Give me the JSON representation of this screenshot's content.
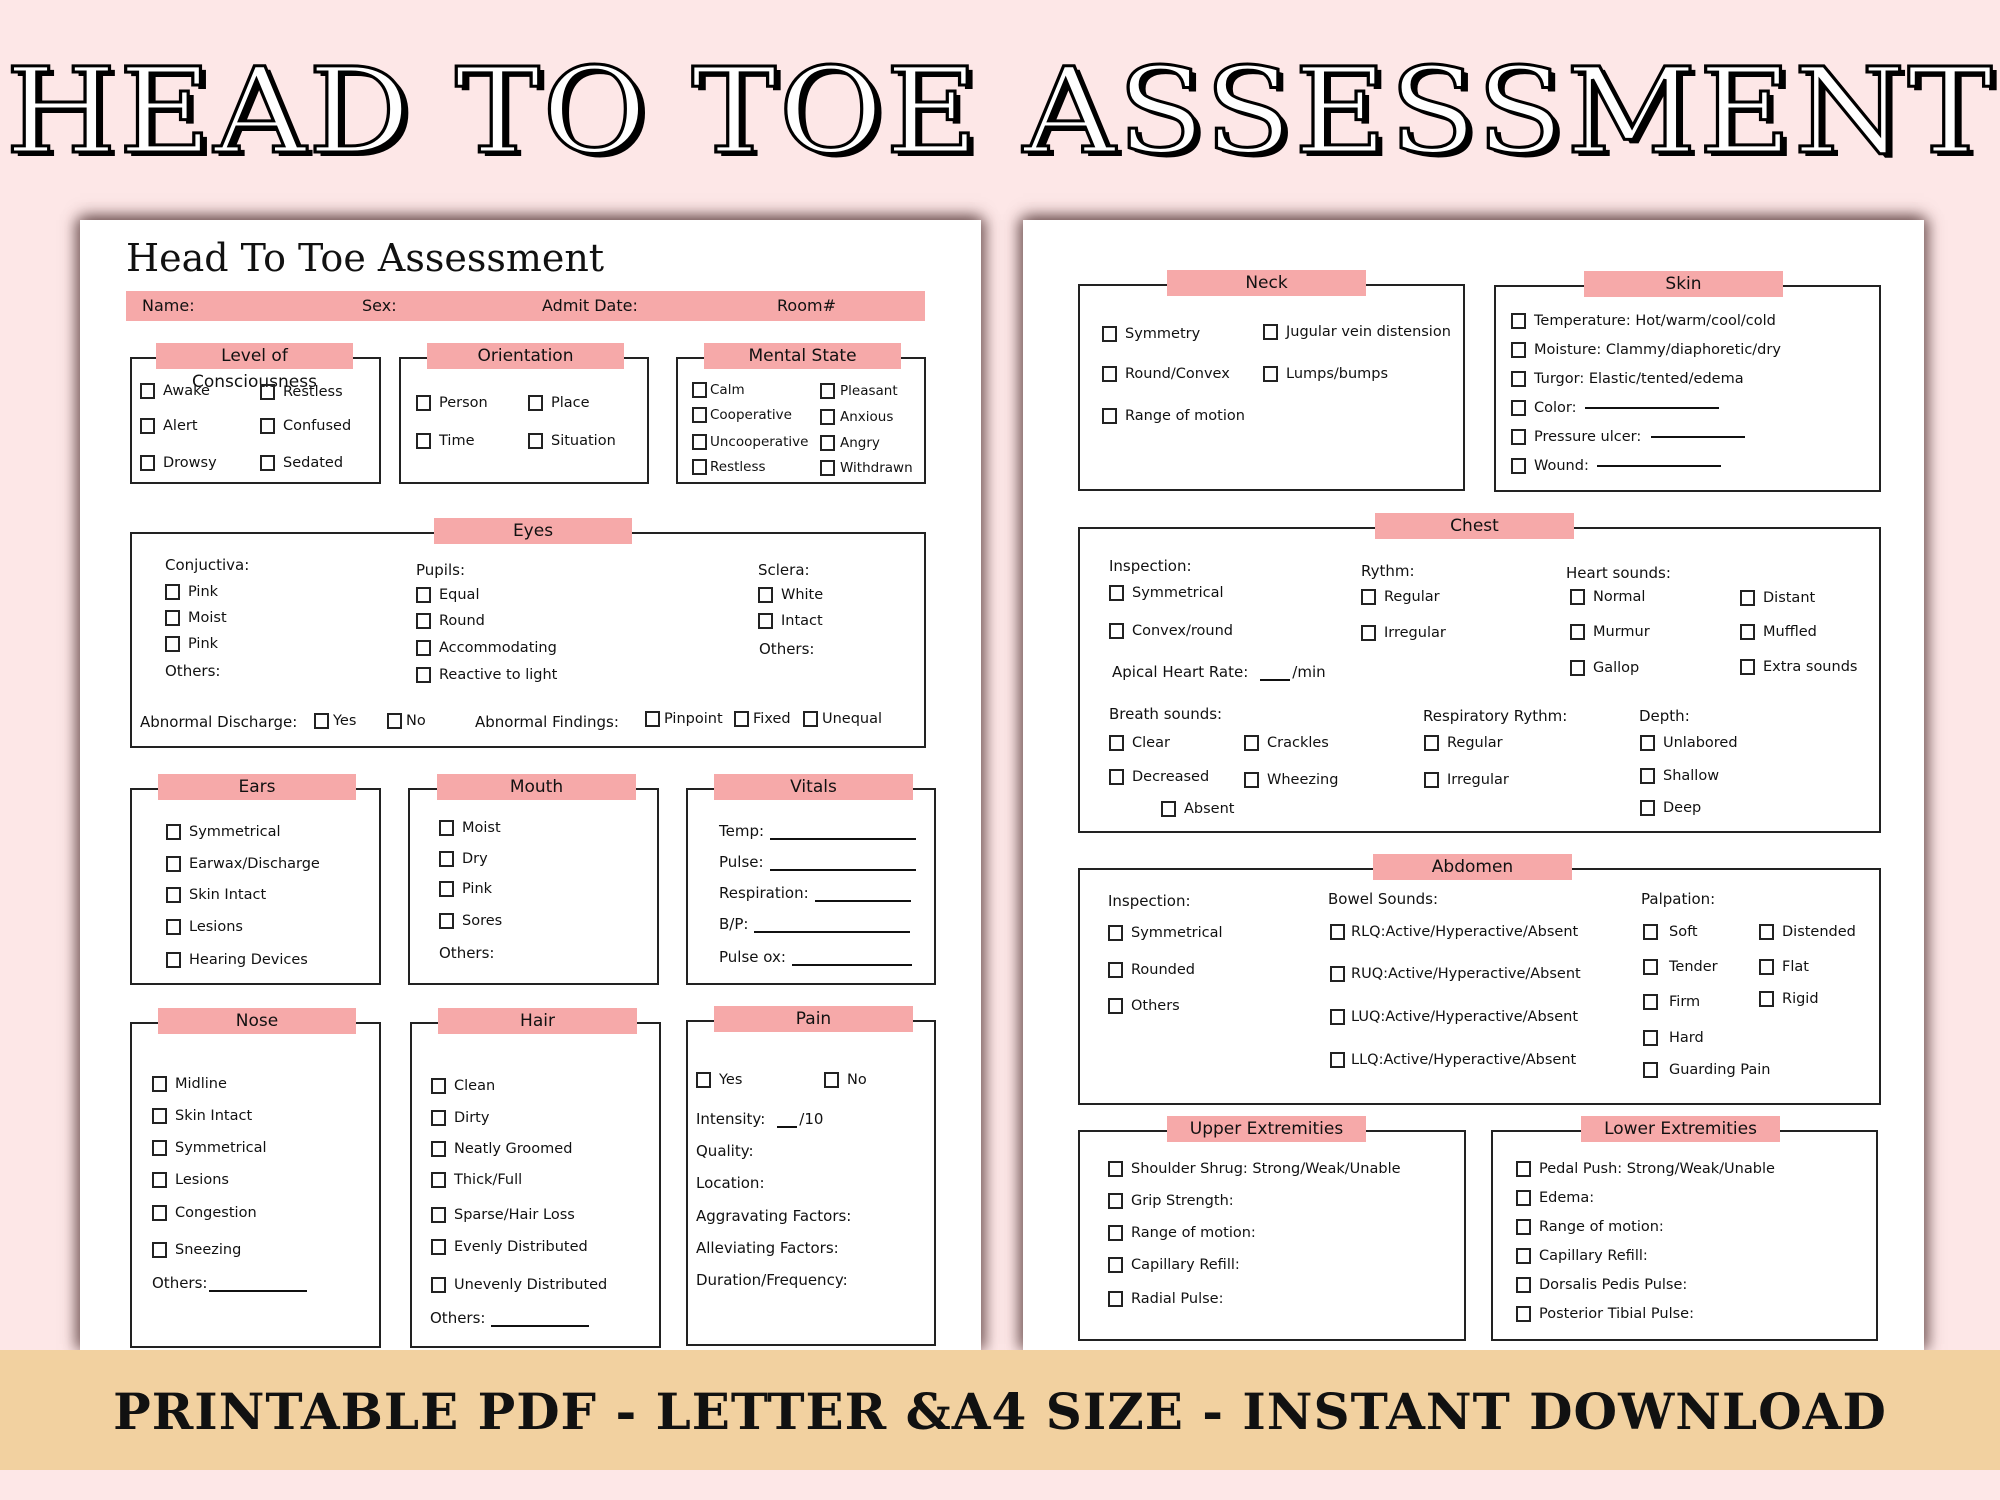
{
  "header": {
    "title": "HEAD TO TOE ASSESSMENT"
  },
  "left_page": {
    "title": "Head To Toe Assessment",
    "info_bar": {
      "name": "Name:",
      "sex": "Sex:",
      "admit_date": "Admit Date:",
      "room": "Room#"
    },
    "consciousness": {
      "title": "Level of Consciousness",
      "items": [
        "Awake",
        "Alert",
        "Drowsy",
        "Restless",
        "Confused",
        "Sedated"
      ]
    },
    "orientation": {
      "title": "Orientation",
      "items": [
        "Person",
        "Time",
        "Place",
        "Situation"
      ]
    },
    "mental_state": {
      "title": "Mental State",
      "items": [
        "Calm",
        "Cooperative",
        "Uncooperative",
        "Restless",
        "Pleasant",
        "Anxious",
        "Angry",
        "Withdrawn"
      ]
    },
    "eyes": {
      "title": "Eyes",
      "conjunctiva_label": "Conjuctiva:",
      "conjunctiva": [
        "Pink",
        "Moist",
        "Pink"
      ],
      "conjunctiva_others": "Others:",
      "pupils_label": "Pupils:",
      "pupils": [
        "Equal",
        "Round",
        "Accommodating",
        "Reactive to light"
      ],
      "sclera_label": "Sclera:",
      "sclera": [
        "White",
        "Intact"
      ],
      "sclera_others": "Others:",
      "discharge_label": "Abnormal Discharge:",
      "discharge": [
        "Yes",
        "No"
      ],
      "findings_label": "Abnormal Findings:",
      "findings": [
        "Pinpoint",
        "Fixed",
        "Unequal"
      ]
    },
    "ears": {
      "title": "Ears",
      "items": [
        "Symmetrical",
        "Earwax/Discharge",
        "Skin Intact",
        "Lesions",
        "Hearing Devices"
      ]
    },
    "mouth": {
      "title": "Mouth",
      "items": [
        "Moist",
        "Dry",
        "Pink",
        "Sores"
      ],
      "others": "Others:"
    },
    "vitals": {
      "title": "Vitals",
      "fields": [
        "Temp:",
        "Pulse:",
        "Respiration:",
        "B/P:",
        "Pulse ox:"
      ]
    },
    "nose": {
      "title": "Nose",
      "items": [
        "Midline",
        "Skin Intact",
        "Symmetrical",
        "Lesions",
        "Congestion",
        "Sneezing"
      ],
      "others": "Others:"
    },
    "hair": {
      "title": "Hair",
      "items": [
        "Clean",
        "Dirty",
        "Neatly Groomed",
        "Thick/Full",
        "Sparse/Hair Loss",
        "Evenly Distributed",
        "Unevenly Distributed"
      ],
      "others": "Others:"
    },
    "pain": {
      "title": "Pain",
      "options": [
        "Yes",
        "No"
      ],
      "intensity_label": "Intensity:",
      "intensity_suffix": "/10",
      "fields": [
        "Quality:",
        "Location:",
        "Aggravating Factors:",
        "Alleviating Factors:",
        "Duration/Frequency:"
      ]
    }
  },
  "right_page": {
    "neck": {
      "title": "Neck",
      "items": [
        "Symmetry",
        "Round/Convex",
        "Range of motion",
        "Jugular vein distension",
        "Lumps/bumps"
      ]
    },
    "skin": {
      "title": "Skin",
      "items": [
        "Temperature: Hot/warm/cool/cold",
        "Moisture: Clammy/diaphoretic/dry",
        "Turgor: Elastic/tented/edema",
        "Color:",
        "Pressure ulcer:",
        "Wound:"
      ]
    },
    "chest": {
      "title": "Chest",
      "inspection_label": "Inspection:",
      "inspection": [
        "Symmetrical",
        "Convex/round"
      ],
      "rhythm_label": "Rythm:",
      "rhythm": [
        "Regular",
        "Irregular"
      ],
      "heart_label": "Heart sounds:",
      "heart": [
        "Normal",
        "Murmur",
        "Gallop",
        "Distant",
        "Muffled",
        "Extra sounds"
      ],
      "apical_label": "Apical Heart Rate:",
      "apical_suffix": "/min",
      "breath_label": "Breath sounds:",
      "breath": [
        "Clear",
        "Decreased",
        "Crackles",
        "Wheezing",
        "Absent"
      ],
      "resp_label": "Respiratory Rythm:",
      "resp": [
        "Regular",
        "Irregular"
      ],
      "depth_label": "Depth:",
      "depth": [
        "Unlabored",
        "Shallow",
        "Deep"
      ]
    },
    "abdomen": {
      "title": "Abdomen",
      "inspection_label": "Inspection:",
      "inspection": [
        "Symmetrical",
        "Rounded",
        "Others"
      ],
      "bowel_label": "Bowel Sounds:",
      "bowel": [
        "RLQ:Active/Hyperactive/Absent",
        "RUQ:Active/Hyperactive/Absent",
        "LUQ:Active/Hyperactive/Absent",
        "LLQ:Active/Hyperactive/Absent"
      ],
      "palpation_label": "Palpation:",
      "palpation": [
        "Soft",
        "Tender",
        "Firm",
        "Hard",
        "Guarding Pain",
        "Distended",
        "Flat",
        "Rigid"
      ]
    },
    "upper": {
      "title": "Upper Extremities",
      "items": [
        "Shoulder Shrug: Strong/Weak/Unable",
        "Grip Strength:",
        "Range of motion:",
        "Capillary Refill:",
        "Radial Pulse:"
      ]
    },
    "lower": {
      "title": "Lower Extremities",
      "items": [
        "Pedal Push: Strong/Weak/Unable",
        "Edema:",
        "Range of motion:",
        "Capillary Refill:",
        "Dorsalis Pedis Pulse:",
        "Posterior Tibial Pulse:"
      ]
    }
  },
  "banner": {
    "text": "PRINTABLE PDF - LETTER &A4 SIZE - INSTANT DOWNLOAD"
  },
  "colors": {
    "background": "#fde7e7",
    "accent_pink": "#f6a9a9",
    "banner": "#f2d1a0"
  }
}
